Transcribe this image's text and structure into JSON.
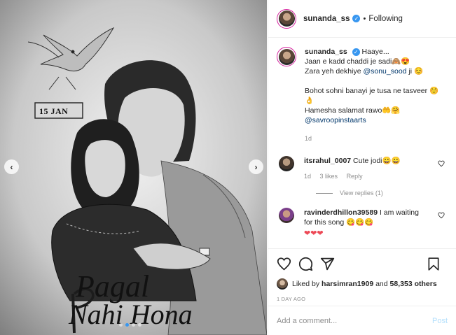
{
  "post": {
    "username": "sunanda_ss",
    "follow_status": "Following",
    "separator": "•",
    "verified_glyph": "✓",
    "image_text": {
      "date_sign": "15 JAN",
      "title_line1": "Pagal",
      "title_line2": "Nahi Hona"
    }
  },
  "caption": {
    "username": "sunanda_ss",
    "verified_glyph": "✓",
    "lines": [
      "Haaye...",
      "Jaan e kadd chaddi je sadi🙈😍",
      "Zara yeh dekhiye",
      "@sonu_sood",
      "ji ☺️",
      "Bohot sohni banayi je tusa ne tasveer ☺️👌",
      "Hamesha salamat rawo🤲🤗",
      "@savroopinstaarts"
    ],
    "time": "1d"
  },
  "comments": [
    {
      "username": "itsrahul_0007",
      "text": "Cute jodi😀😀",
      "time": "1d",
      "likes": "3 likes",
      "reply": "Reply",
      "view_replies": "View replies (1)"
    },
    {
      "username": "ravinderdhillon39589",
      "text": "I am waiting for this song 😋😋😋",
      "hearts": "❤❤❤"
    }
  ],
  "likes": {
    "prefix": "Liked by",
    "user": "harsimran1909",
    "connector": "and",
    "others": "58,353 others"
  },
  "date": "1 DAY AGO",
  "add_comment": {
    "placeholder": "Add a comment...",
    "post_label": "Post"
  },
  "nav": {
    "prev": "‹",
    "next": "›"
  },
  "colors": {
    "accent": "#3897f0",
    "mention": "#00376b",
    "meta": "#8e8e8e",
    "heart_red": "#ed4956"
  }
}
